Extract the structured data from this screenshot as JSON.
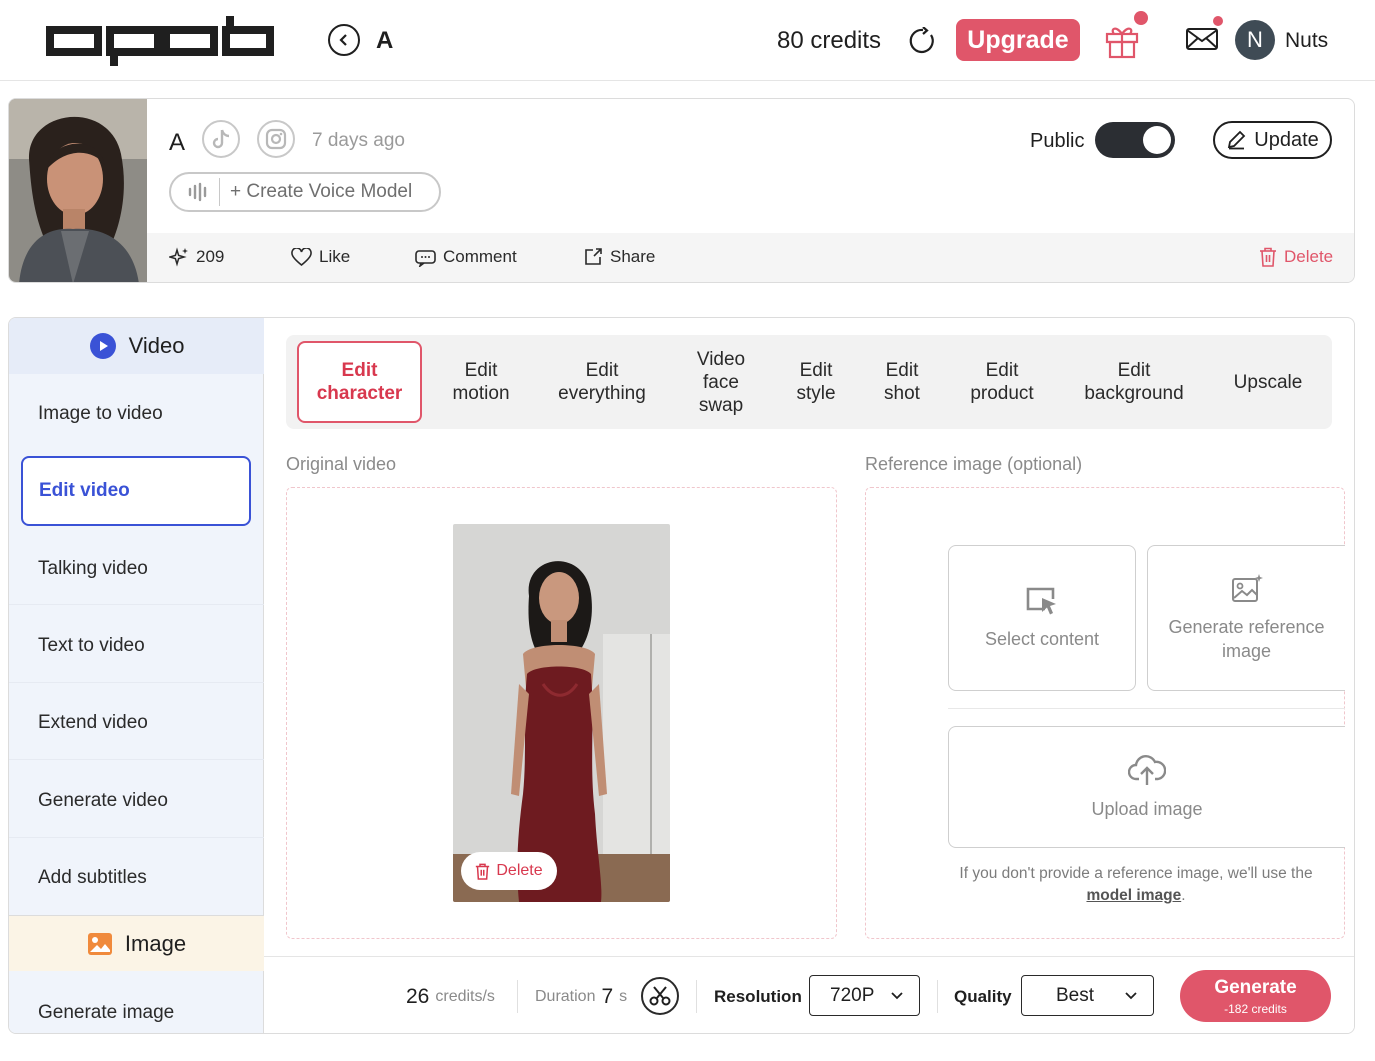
{
  "topbar": {
    "logo_name": "opob",
    "title": "A",
    "credits": "80 credits",
    "upgrade_label": "Upgrade",
    "user_initial": "N",
    "user_name": "Nuts"
  },
  "profile": {
    "name": "A",
    "time_ago": "7 days ago",
    "voice_label": "+ Create Voice Model",
    "public_label": "Public",
    "public_on": true,
    "update_label": "Update",
    "stats": {
      "generations": "209",
      "like": "Like",
      "comment": "Comment",
      "share": "Share",
      "delete": "Delete"
    }
  },
  "sidebar": {
    "video_header": "Video",
    "items": [
      "Image to video",
      "Edit video",
      "Talking video",
      "Text to video",
      "Extend video",
      "Generate video",
      "Add subtitles"
    ],
    "image_header": "Image",
    "image_items": [
      "Generate image"
    ]
  },
  "tabs": [
    "Edit character",
    "Edit motion",
    "Edit everything",
    "Video face swap",
    "Edit style",
    "Edit shot",
    "Edit product",
    "Edit background",
    "Upscale"
  ],
  "original": {
    "label": "Original video",
    "delete_label": "Delete"
  },
  "reference": {
    "label": "Reference image (optional)",
    "select_content": "Select content",
    "generate_reference": "Generate reference image",
    "upload_image": "Upload image",
    "hint_prefix": "If you don't provide a reference image, we'll use the",
    "hint_link": "model image",
    "hint_suffix": "."
  },
  "bottom": {
    "credits_rate_value": "26",
    "credits_rate_unit": "credits/s",
    "duration_label": "Duration",
    "duration_value": "7",
    "duration_unit": "s",
    "resolution_label": "Resolution",
    "resolution_value": "720P",
    "quality_label": "Quality",
    "quality_value": "Best",
    "generate_label": "Generate",
    "generate_cost": "-182 credits"
  },
  "colors": {
    "accent": "#e0566a",
    "active_blue": "#3a52d6",
    "sidebar_bg": "#f0f4fb"
  }
}
